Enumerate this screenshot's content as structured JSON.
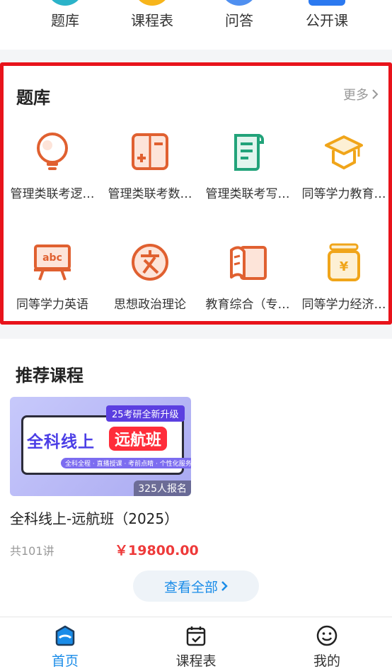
{
  "top_nav": {
    "items": [
      {
        "label": "题库",
        "color": "#2bb3c9"
      },
      {
        "label": "课程表",
        "color": "#f7b51b"
      },
      {
        "label": "问答",
        "color": "#4f8ff0"
      },
      {
        "label": "公开课",
        "color": "#2b79f0"
      }
    ]
  },
  "question_bank": {
    "title": "题库",
    "more_label": "更多",
    "items": [
      {
        "label": "管理类联考逻…",
        "icon": "lightbulb-icon",
        "color": "#e06030"
      },
      {
        "label": "管理类联考数…",
        "icon": "calculator-icon",
        "color": "#e06030"
      },
      {
        "label": "管理类联考写…",
        "icon": "scroll-icon",
        "color": "#22a37a"
      },
      {
        "label": "同等学力教育…",
        "icon": "graduation-cap-icon",
        "color": "#f0a51a"
      },
      {
        "label": "同等学力英语",
        "icon": "abc-board-icon",
        "color": "#e06030"
      },
      {
        "label": "思想政治理论",
        "icon": "culture-icon",
        "color": "#e06030"
      },
      {
        "label": "教育综合（专…",
        "icon": "book-icon",
        "color": "#e06030"
      },
      {
        "label": "同等学力经济…",
        "icon": "money-jar-icon",
        "color": "#f0a51a"
      }
    ]
  },
  "recommended": {
    "title": "推荐课程",
    "course": {
      "cover_tag": "25考研全新升级",
      "cover_main": "全科线上",
      "cover_highlight": "远航班",
      "cover_sub": "全科全程 · 直播授课 · 考前点睛 · 个性化服务",
      "enrolled": "325人报名",
      "name": "全科线上-远航班（2025）",
      "lessons": "共101讲",
      "price": "￥19800.00"
    },
    "see_all_label": "查看全部"
  },
  "tabbar": {
    "items": [
      {
        "label": "首页",
        "icon": "home-icon",
        "active": true
      },
      {
        "label": "课程表",
        "icon": "calendar-check-icon",
        "active": false
      },
      {
        "label": "我的",
        "icon": "smiley-icon",
        "active": false
      }
    ],
    "active_color": "#1a8ce8"
  }
}
